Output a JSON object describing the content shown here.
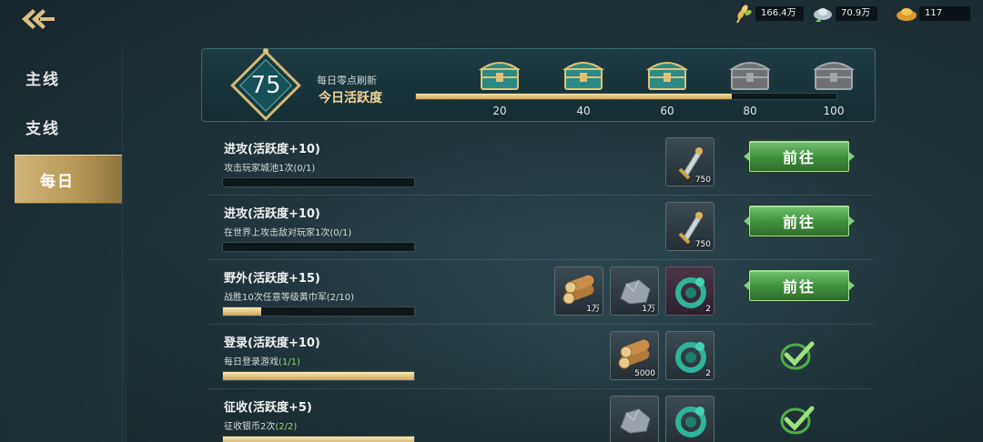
{
  "topbar": {
    "back_icon": "back-arrow-icon",
    "currencies": [
      {
        "name": "food",
        "icon": "wheat-icon",
        "value": "166.4万"
      },
      {
        "name": "silver",
        "icon": "silver-ingot-icon",
        "value": "70.9万"
      },
      {
        "name": "gold",
        "icon": "gold-ingot-icon",
        "value": "117"
      }
    ]
  },
  "sidebar": {
    "items": [
      {
        "label": "主线",
        "active": false
      },
      {
        "label": "支线",
        "active": false
      },
      {
        "label": "每日",
        "active": true
      }
    ]
  },
  "activity": {
    "points": "75",
    "refresh_text": "每日零点刷新",
    "title": "今日活跃度",
    "progress_fraction": 0.75,
    "milestones": [
      {
        "label": "20",
        "unlocked": true
      },
      {
        "label": "40",
        "unlocked": true
      },
      {
        "label": "60",
        "unlocked": true
      },
      {
        "label": "80",
        "unlocked": false
      },
      {
        "label": "100",
        "unlocked": false
      }
    ]
  },
  "tasks": [
    {
      "title": "进攻(活跃度+10)",
      "desc": "攻击玩家城池1次",
      "progress_text": "(0/1)",
      "progress_fraction": 0,
      "rewards": [
        {
          "icon": "sword-token-icon",
          "qty": "750"
        }
      ],
      "action": "button",
      "button_label": "前往"
    },
    {
      "title": "进攻(活跃度+10)",
      "desc": "在世界上攻击敌对玩家1次",
      "progress_text": "(0/1)",
      "progress_fraction": 0,
      "rewards": [
        {
          "icon": "sword-token-icon",
          "qty": "750"
        }
      ],
      "action": "button",
      "button_label": "前往"
    },
    {
      "title": "野外(活跃度+15)",
      "desc": "战胜10次任意等级黄巾军",
      "progress_text": "(2/10)",
      "progress_fraction": 0.2,
      "rewards": [
        {
          "icon": "wood-icon",
          "qty": "1万"
        },
        {
          "icon": "stone-icon",
          "qty": "1万"
        },
        {
          "icon": "jade-dragon-icon",
          "qty": "2"
        }
      ],
      "action": "button",
      "button_label": "前往"
    },
    {
      "title": "登录(活跃度+10)",
      "desc": "每日登录游戏",
      "progress_text": "(1/1)",
      "progress_fraction": 1,
      "rewards": [
        {
          "icon": "wood-icon",
          "qty": "5000"
        },
        {
          "icon": "jade-dragon-icon",
          "qty": "2"
        }
      ],
      "action": "complete"
    },
    {
      "title": "征收(活跃度+5)",
      "desc": "征收银币2次",
      "progress_text": "(2/2)",
      "progress_fraction": 1,
      "rewards": [
        {
          "icon": "stone-icon",
          "qty": ""
        },
        {
          "icon": "jade-dragon-icon",
          "qty": ""
        }
      ],
      "action": "complete"
    }
  ]
}
